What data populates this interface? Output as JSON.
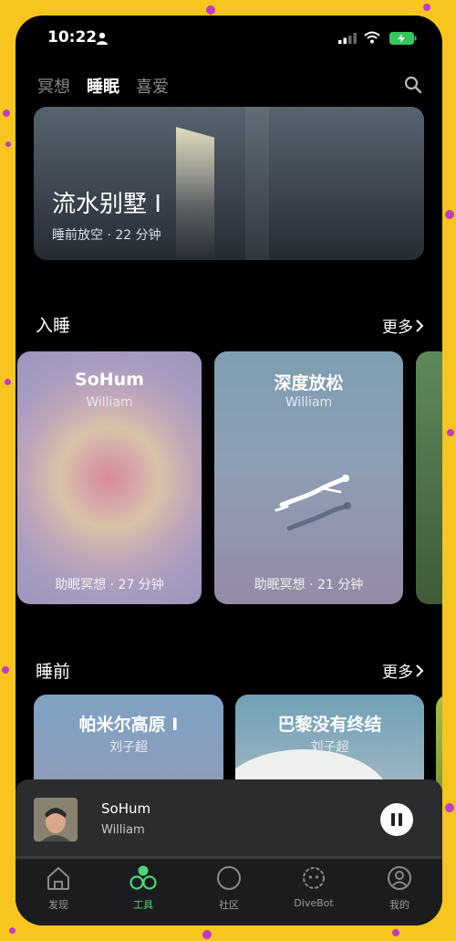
{
  "status_bar": {
    "time": "10:22"
  },
  "top_tabs": [
    {
      "label": "冥想",
      "active": false
    },
    {
      "label": "睡眠",
      "active": true
    },
    {
      "label": "喜爱",
      "active": false
    }
  ],
  "hero": {
    "title": "流水别墅 I",
    "subtitle": "睡前放空 · 22 分钟"
  },
  "section_sleep": {
    "title": "入睡",
    "more": "更多",
    "cards": [
      {
        "title": "SoHum",
        "author": "William",
        "meta": "助眠冥想 · 27 分钟"
      },
      {
        "title": "深度放松",
        "author": "William",
        "meta": "助眠冥想 · 21 分钟"
      }
    ]
  },
  "section_bedtime": {
    "title": "睡前",
    "more": "更多",
    "cards": [
      {
        "title": "帕米尔高原 I",
        "author": "刘子超"
      },
      {
        "title": "巴黎没有终结",
        "author": "刘子超"
      }
    ]
  },
  "mini_player": {
    "title": "SoHum",
    "artist": "William",
    "state": "playing"
  },
  "bottom_nav": [
    {
      "label": "发现",
      "icon": "house-icon",
      "active": false
    },
    {
      "label": "工具",
      "icon": "tools-icon",
      "active": true
    },
    {
      "label": "社区",
      "icon": "circle-icon",
      "active": false
    },
    {
      "label": "DiveBot",
      "icon": "bot-icon",
      "active": false
    },
    {
      "label": "我的",
      "icon": "profile-icon",
      "active": false
    }
  ],
  "colors": {
    "accent_green": "#4fd47a",
    "frame_yellow": "#f7c51e",
    "frame_dots": "#c03cc8",
    "background": "#000000"
  }
}
